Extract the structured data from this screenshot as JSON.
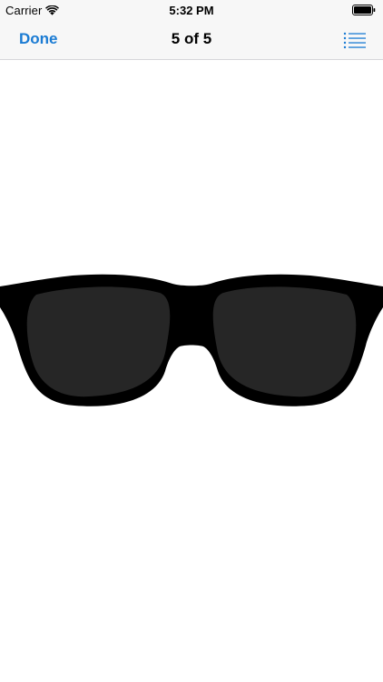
{
  "status_bar": {
    "carrier": "Carrier",
    "time": "5:32 PM",
    "wifi_icon": "wifi-icon",
    "battery_icon": "battery-icon"
  },
  "nav_bar": {
    "done_label": "Done",
    "title": "5 of 5",
    "list_icon": "list-icon",
    "accent_color": "#1a7bd3"
  },
  "content": {
    "image": "sunglasses-image",
    "frame_color": "#000000",
    "lens_color": "#262626"
  }
}
